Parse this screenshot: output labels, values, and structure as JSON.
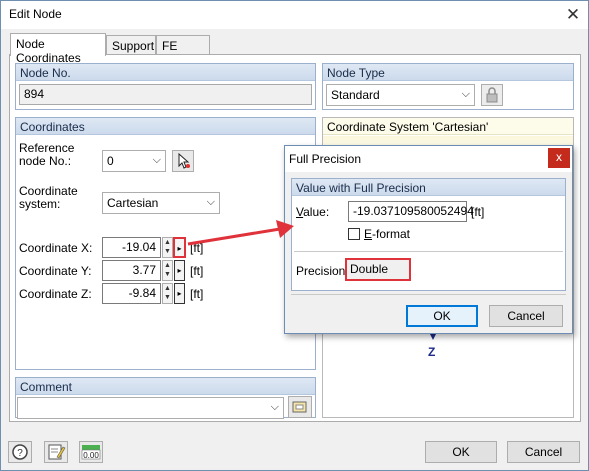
{
  "window": {
    "title": "Edit Node",
    "close_glyph": "✕"
  },
  "tabs": [
    {
      "label": "Node Coordinates",
      "active": true
    },
    {
      "label": "Support",
      "active": false
    },
    {
      "label": "FE Mesh",
      "active": false
    }
  ],
  "node_no": {
    "header": "Node No.",
    "value": "894"
  },
  "node_type": {
    "header": "Node Type",
    "value": "Standard"
  },
  "coordinates": {
    "header": "Coordinates",
    "reference_label_1": "Reference",
    "reference_label_2": "node No.:",
    "reference_value": "0",
    "system_label_1": "Coordinate",
    "system_label_2": "system:",
    "system_value": "Cartesian",
    "x_label": "Coordinate X:",
    "x_value": "-19.04",
    "y_label": "Coordinate Y:",
    "y_value": "3.77",
    "z_label": "Coordinate Z:",
    "z_value": "-9.84",
    "unit": "[ft]"
  },
  "coord_system_panel": {
    "header": "Coordinate System 'Cartesian'",
    "axis_label": "Z"
  },
  "comment": {
    "header": "Comment",
    "value": ""
  },
  "footer": {
    "ok": "OK",
    "cancel": "Cancel"
  },
  "precision_dialog": {
    "title": "Full Precision",
    "close_glyph": "x",
    "group_header": "Value with Full Precision",
    "value_label": "Value:",
    "value": "-19.037109580052494",
    "unit": "[ft]",
    "eformat_label": "E-format",
    "eformat_checked": false,
    "precision_label": "Precision:",
    "precision_value": "Double",
    "ok": "OK",
    "cancel": "Cancel"
  },
  "colors": {
    "accent": "#0078d7",
    "highlight": "#e0323a",
    "group_header": "#ccdaec"
  }
}
